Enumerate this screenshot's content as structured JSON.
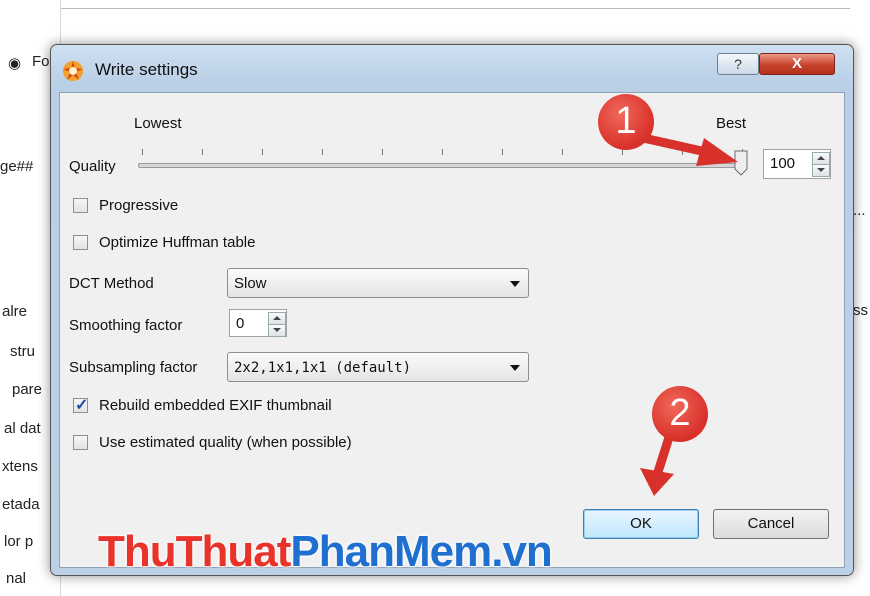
{
  "background": {
    "fragments": [
      "Fo",
      "ge##",
      "alre",
      "stru",
      "pare",
      "al dat",
      "xtens",
      "etada",
      "lor p",
      "nal",
      "ss",
      "..."
    ]
  },
  "dialog": {
    "title": "Write settings",
    "help_label": "?",
    "close_label": "X",
    "quality": {
      "label": "Quality",
      "low_label": "Lowest",
      "high_label": "Best",
      "slider_fraction": 1.0,
      "value": "100"
    },
    "progressive": {
      "label": "Progressive",
      "checked": false
    },
    "optimize_huffman": {
      "label": "Optimize Huffman table",
      "checked": false
    },
    "dct_method": {
      "label": "DCT Method",
      "value": "Slow"
    },
    "smoothing_factor": {
      "label": "Smoothing factor",
      "value": "0"
    },
    "subsampling_factor": {
      "label": "Subsampling factor",
      "value": "2x2,1x1,1x1 (default)"
    },
    "rebuild_exif": {
      "label": "Rebuild embedded EXIF thumbnail",
      "checked": true
    },
    "estimated_quality": {
      "label": "Use estimated quality (when possible)",
      "checked": false
    },
    "ok_label": "OK",
    "cancel_label": "Cancel"
  },
  "annotations": {
    "marker1": "1",
    "marker2": "2",
    "marker_color": "#d8302a"
  },
  "watermark": {
    "part1": "ThuThuat",
    "part2": "PhanMem",
    "part3": ".vn",
    "color1": "#e8322a",
    "color2": "#1e6fd0"
  }
}
